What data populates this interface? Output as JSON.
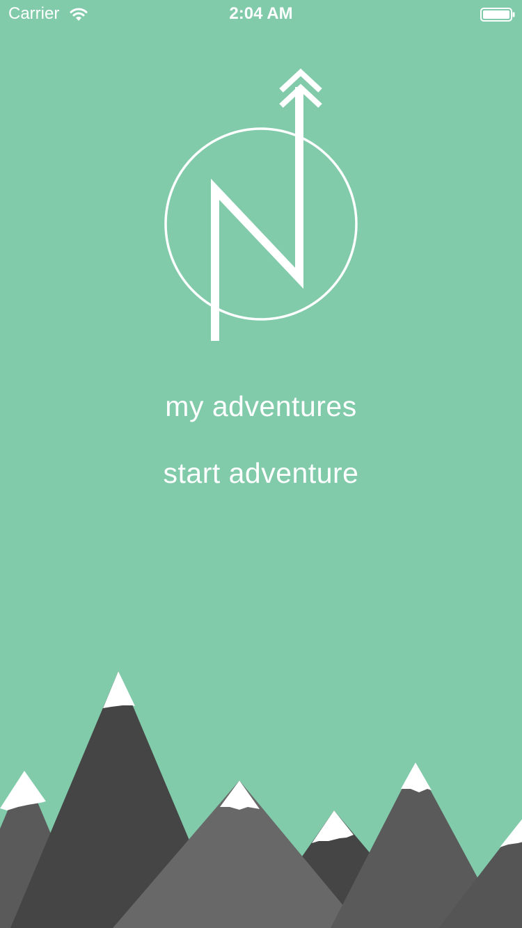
{
  "status_bar": {
    "carrier": "Carrier",
    "time": "2:04 AM",
    "wifi_icon": "wifi-icon",
    "battery_icon": "battery-icon"
  },
  "app": {
    "logo_icon": "compass-north-logo",
    "menu": {
      "my_adventures": "my adventures",
      "start_adventure": "start adventure"
    }
  },
  "colors": {
    "background": "#81cbab",
    "foreground": "#ffffff",
    "mountain_dark": "#454545",
    "mountain_mid": "#5a5a5a",
    "mountain_light": "#686868",
    "snow": "#ffffff"
  }
}
